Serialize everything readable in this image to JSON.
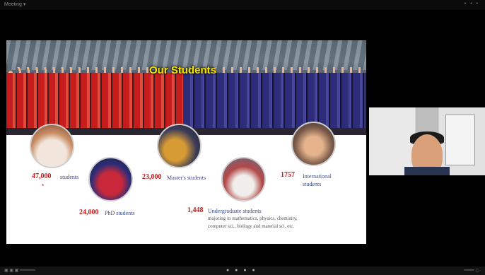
{
  "app": {
    "title": "Meeting ▾",
    "window_controls": "• • •"
  },
  "slide": {
    "title": "Our Students",
    "stats": [
      {
        "number": "47,000",
        "label": "students",
        "note": "*"
      },
      {
        "number": "24,000",
        "label": "PhD students"
      },
      {
        "number": "23,000",
        "label": "Master's students"
      },
      {
        "number": "1,448",
        "label": "Undergraduate students",
        "description": "majoring in mathematics, physics, chemistry, computer sci., biology and material sci. etc."
      },
      {
        "number": "1757",
        "label": "International students"
      }
    ]
  },
  "toolbar": {
    "left_text": "▣ ▣ ▣ ━━━━━━",
    "center_icons": "● ● ● ●",
    "right_text": "━━━━ ▢"
  }
}
